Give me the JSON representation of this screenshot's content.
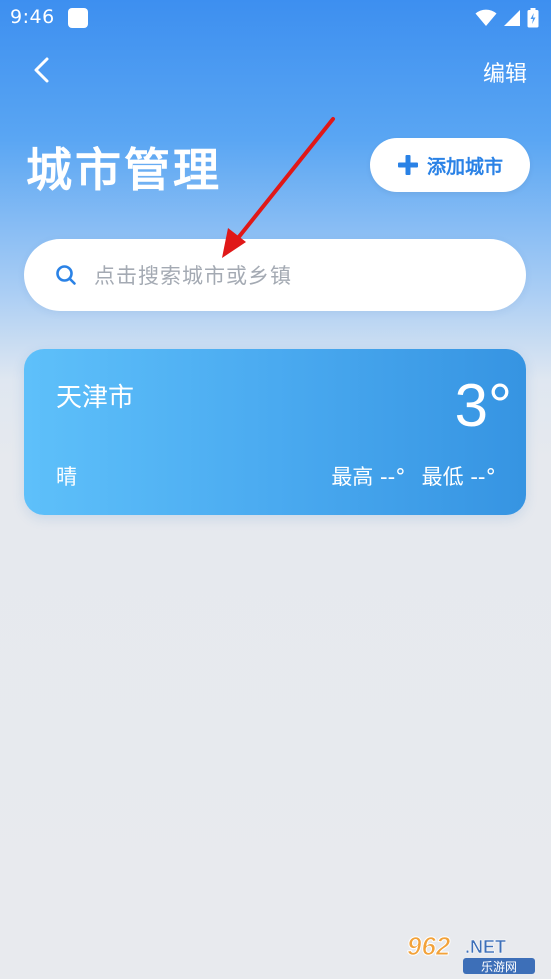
{
  "status_bar": {
    "time": "9:46"
  },
  "header": {
    "edit_label": "编辑",
    "title": "城市管理",
    "add_city_label": "添加城市"
  },
  "search": {
    "placeholder": "点击搜索城市或乡镇"
  },
  "cities": [
    {
      "name": "天津市",
      "temperature": "3°",
      "weather": "晴",
      "high": "最高 --°",
      "low": "最低 --°"
    }
  ],
  "watermark": {
    "logo_text": "962.NET",
    "sub_text": "乐游网"
  },
  "colors": {
    "accent": "#2a82e6",
    "arrow": "#e01818"
  },
  "icons": {
    "back": "chevron-left-icon",
    "add": "plus-icon",
    "search": "search-icon",
    "wifi": "wifi-icon",
    "signal": "signal-icon",
    "battery": "battery-icon"
  }
}
